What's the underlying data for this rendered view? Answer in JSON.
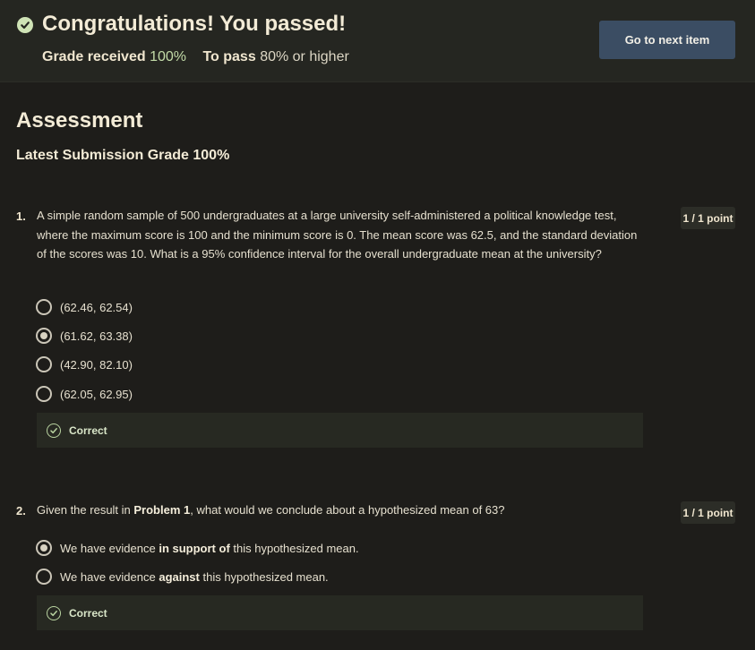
{
  "banner": {
    "title": "Congratulations! You passed!",
    "grade_received_label": "Grade received",
    "grade_received_value": "100%",
    "to_pass_label": "To pass",
    "to_pass_value": "80% or higher",
    "next_button_label": "Go to next item"
  },
  "assessment": {
    "heading": "Assessment",
    "latest_grade": "Latest Submission Grade 100%"
  },
  "questions": [
    {
      "number": "1.",
      "text": "A simple random sample of 500 undergraduates at a large university self-administered a political knowledge test, where the maximum score is 100 and the minimum score is 0. The mean score was 62.5, and the standard deviation of the scores was 10. What is a 95% confidence interval for the overall undergraduate mean at the university?",
      "points": "1 / 1 point",
      "options": [
        "(62.46, 62.54)",
        "(61.62, 63.38)",
        "(42.90, 82.10)",
        "(62.05, 62.95)"
      ],
      "selected_index": 1,
      "feedback": "Correct"
    },
    {
      "number": "2.",
      "text_parts": [
        "Given the result in ",
        "Problem 1",
        ", what would we conclude about a hypothesized mean of 63?"
      ],
      "points": "1 / 1 point",
      "options": [
        {
          "before": "We have evidence ",
          "bold": "in support of",
          "after": " this hypothesized mean."
        },
        {
          "before": "We have evidence ",
          "bold": "against",
          "after": " this hypothesized mean."
        }
      ],
      "selected_index": 0,
      "feedback": "Correct"
    }
  ]
}
